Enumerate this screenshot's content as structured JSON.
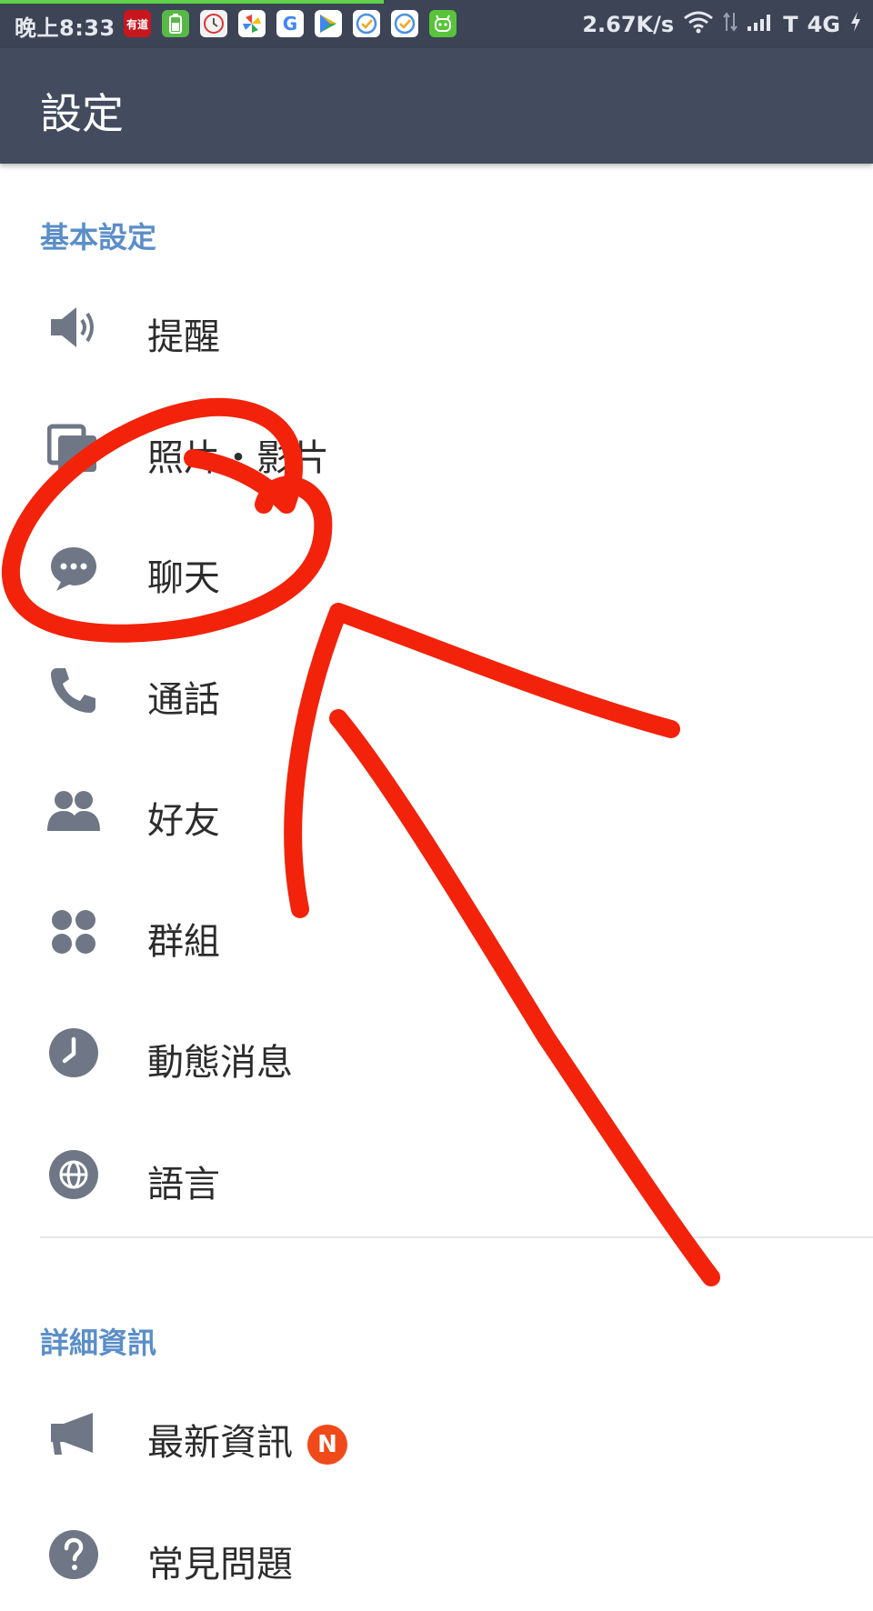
{
  "status_bar": {
    "time": "晚上8:33",
    "apps": [
      {
        "name": "youdao-icon",
        "text": "有道",
        "color": "#c8161d"
      },
      {
        "name": "battery-app-icon",
        "text": "",
        "color": "#58b947"
      },
      {
        "name": "clock-app-icon",
        "text": "",
        "color": "#f2f2f2"
      },
      {
        "name": "photos-icon",
        "text": "",
        "color": "#ffffff"
      },
      {
        "name": "google-icon",
        "text": "G",
        "color": "#ffffff"
      },
      {
        "name": "play-store-icon",
        "text": "",
        "color": "#ffffff"
      },
      {
        "name": "task-check-icon",
        "text": "",
        "color": "#ffffff"
      },
      {
        "name": "task-check-icon-2",
        "text": "",
        "color": "#ffffff"
      },
      {
        "name": "android-app-icon",
        "text": "",
        "color": "#58c33b"
      }
    ],
    "speed": "2.67K/s",
    "carrier": "T",
    "network": "4G"
  },
  "header": {
    "title": "設定"
  },
  "sections": {
    "basic": {
      "title": "基本設定",
      "items": [
        {
          "label": "提醒",
          "icon": "speaker-icon"
        },
        {
          "label": "照片・影片",
          "icon": "photos-videos-icon"
        },
        {
          "label": "聊天",
          "icon": "chat-bubble-icon"
        },
        {
          "label": "通話",
          "icon": "phone-icon"
        },
        {
          "label": "好友",
          "icon": "friends-icon"
        },
        {
          "label": "群組",
          "icon": "groups-icon"
        },
        {
          "label": "動態消息",
          "icon": "clock-icon"
        },
        {
          "label": "語言",
          "icon": "globe-icon"
        }
      ]
    },
    "details": {
      "title": "詳細資訊",
      "items": [
        {
          "label": "最新資訊",
          "icon": "megaphone-icon",
          "badge": "N"
        },
        {
          "label": "常見問題",
          "icon": "help-icon"
        }
      ]
    }
  },
  "colors": {
    "toolbar": "#434b5f",
    "section_header": "#5b8ec9",
    "icon": "#6f7786",
    "badge": "#f04a1b",
    "annotation": "#f2230a"
  }
}
